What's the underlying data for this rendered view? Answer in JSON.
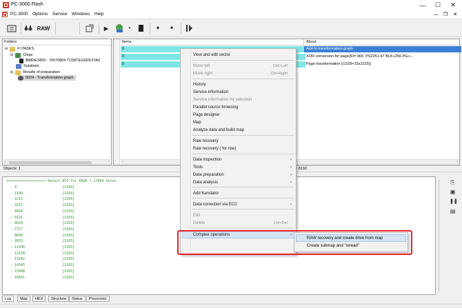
{
  "window": {
    "title": "PC-3000 Flash",
    "controls": {
      "minimize": "—",
      "maximize": "☐",
      "close": "✕"
    }
  },
  "menubar": {
    "items": [
      "PC-3000",
      "Options",
      "Service",
      "Windows",
      "Help"
    ],
    "mdi": {
      "minimize": "—",
      "restore": "❐",
      "close": "✕"
    }
  },
  "toolbar": {
    "raw_label": "RAW",
    "pause_glyph": "⏸",
    "stop_glyph": "■",
    "play_glyph": "▶"
  },
  "folders": {
    "header": "Folders",
    "tree": [
      "F:\\TASKS",
      "Chips",
      "$98DE3493 - 76570804 TC58TEG6DDJTA0",
      "Solutions",
      "Results of preparation",
      "0024 - Transformation graph"
    ]
  },
  "items_grid": {
    "items_header": "Items",
    "about_header": "About",
    "rows": [
      {
        "item": "0",
        "about": "Add to transformation graph"
      },
      {
        "item": "0",
        "about": "XOR conversion for page(ID= 465: PS2251-67 BLK+256 PG+..."
      },
      {
        "item": "0",
        "about": "Page transformation ((1109+15x1103))"
      }
    ]
  },
  "status": {
    "objects": "Objects: 1",
    "value": "= 8192"
  },
  "log": {
    "header_line": ">>>>>>>>>>>>>>>>>>> Detect ECC for PAGE = 17664 bytes",
    "lines": [
      {
        "offset": "- 0",
        "value": "[1103]"
      },
      {
        "offset": "- 1109",
        "value": "[1103]"
      },
      {
        "offset": "- 2212",
        "value": "[1103]"
      },
      {
        "offset": "- 3315",
        "value": "[1103]"
      },
      {
        "offset": "- 4418",
        "value": "[1103]"
      },
      {
        "offset": "- 5521",
        "value": "[1103]"
      },
      {
        "offset": "- 6624",
        "value": "[1103]"
      },
      {
        "offset": "- 7727",
        "value": "[1103]"
      },
      {
        "offset": "- 8830",
        "value": "[1103]"
      },
      {
        "offset": "- 9933",
        "value": "[1103]"
      },
      {
        "offset": "- 11036",
        "value": "[1103]"
      },
      {
        "offset": "- 12139",
        "value": "[1103]"
      },
      {
        "offset": "- 13242",
        "value": "[1103]"
      },
      {
        "offset": "- 14345",
        "value": "[1103]"
      },
      {
        "offset": "- 15448",
        "value": "[1103]"
      },
      {
        "offset": "- 16551",
        "value": "[1103]"
      }
    ]
  },
  "bottom_tabs": [
    "Log",
    "Map",
    "HEX",
    "Structure",
    "Status",
    "Processes"
  ],
  "context_menu": {
    "items": [
      {
        "label": "View and edit sector",
        "shortcut": "",
        "disabled": false,
        "submenu": false
      },
      {
        "label": "Move left",
        "shortcut": "Ctrl+Left",
        "disabled": true,
        "submenu": false
      },
      {
        "label": "Move right",
        "shortcut": "Ctrl+Right",
        "disabled": true,
        "submenu": false
      },
      {
        "label": "History",
        "shortcut": "",
        "disabled": false,
        "submenu": false
      },
      {
        "label": "Service information",
        "shortcut": "",
        "disabled": false,
        "submenu": false
      },
      {
        "label": "Service information for selection",
        "shortcut": "",
        "disabled": true,
        "submenu": false
      },
      {
        "label": "Parallel source browsing",
        "shortcut": "",
        "disabled": false,
        "submenu": false
      },
      {
        "label": "Page designer",
        "shortcut": "",
        "disabled": false,
        "submenu": false
      },
      {
        "label": "Map",
        "shortcut": "",
        "disabled": false,
        "submenu": false
      },
      {
        "label": "Analyze data and build map",
        "shortcut": "",
        "disabled": false,
        "submenu": false
      },
      {
        "label": "Raw recovery",
        "shortcut": "",
        "disabled": false,
        "submenu": false
      },
      {
        "label": "Raw recovery ( for row)",
        "shortcut": "",
        "disabled": false,
        "submenu": false
      },
      {
        "label": "Data inspection",
        "shortcut": "",
        "disabled": false,
        "submenu": true
      },
      {
        "label": "Tools",
        "shortcut": "",
        "disabled": false,
        "submenu": true
      },
      {
        "label": "Data preparation",
        "shortcut": "",
        "disabled": false,
        "submenu": true
      },
      {
        "label": "Data analysis",
        "shortcut": "",
        "disabled": false,
        "submenu": true
      },
      {
        "label": "Add translator",
        "shortcut": "",
        "disabled": false,
        "submenu": false
      },
      {
        "label": "Data correction via ECC",
        "shortcut": "",
        "disabled": false,
        "submenu": true
      },
      {
        "label": "Edit",
        "shortcut": "",
        "disabled": true,
        "submenu": false
      },
      {
        "label": "Delete",
        "shortcut": "Ctrl+Del",
        "disabled": true,
        "submenu": false
      },
      {
        "label": "Complex operations",
        "shortcut": "",
        "disabled": false,
        "submenu": true,
        "highlighted": true
      }
    ],
    "submenu_arrow": "›"
  },
  "submenu": {
    "items": [
      {
        "label": "RAW recovery and create drive from map",
        "highlighted": true
      },
      {
        "label": "Create submap and \"reread\"",
        "highlighted": false
      }
    ]
  },
  "colors": {
    "accent": "#3c7fd6",
    "selection": "#d7e4f2",
    "cyan_cells": "#7fe6e6",
    "highlight_box": "#e32228",
    "log_text": "#2d8a2d"
  }
}
